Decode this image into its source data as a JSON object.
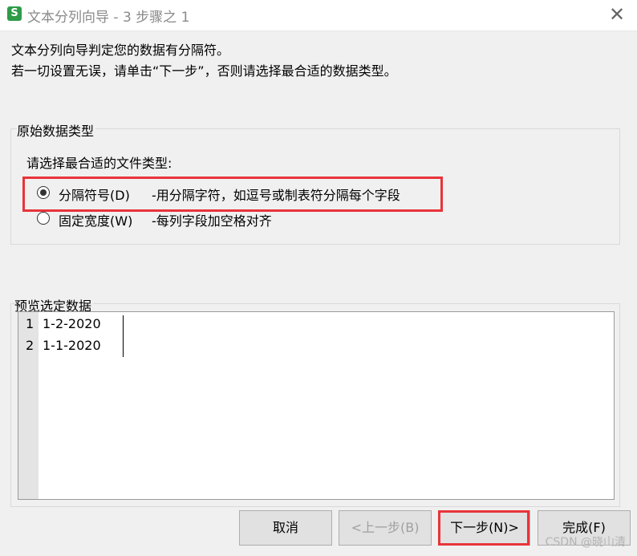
{
  "window": {
    "title": "文本分列向导 - 3 步骤之 1",
    "app_icon_letter": "S",
    "close_glyph": "✕"
  },
  "intro": {
    "line1": "文本分列向导判定您的数据有分隔符。",
    "line2": "若一切设置无误，请单击“下一步”，否则请选择最合适的数据类型。"
  },
  "data_type_group": {
    "caption": "原始数据类型",
    "prompt": "请选择最合适的文件类型:",
    "options": [
      {
        "label": "分隔符号(D)",
        "description": "-用分隔字符，如逗号或制表符分隔每个字段",
        "selected": true
      },
      {
        "label": "固定宽度(W)",
        "description": "-每列字段加空格对齐",
        "selected": false
      }
    ]
  },
  "preview": {
    "caption": "预览选定数据",
    "rows": [
      {
        "num": "1",
        "text": "1-2-2020"
      },
      {
        "num": "2",
        "text": "1-1-2020"
      }
    ]
  },
  "buttons": {
    "cancel": "取消",
    "back": "<上一步(B)",
    "next": "下一步(N)>",
    "finish": "完成(F)"
  },
  "colors": {
    "highlight": "#e8343a",
    "app_icon": "#2e9b48"
  },
  "watermark": "CSDN @晓山清"
}
